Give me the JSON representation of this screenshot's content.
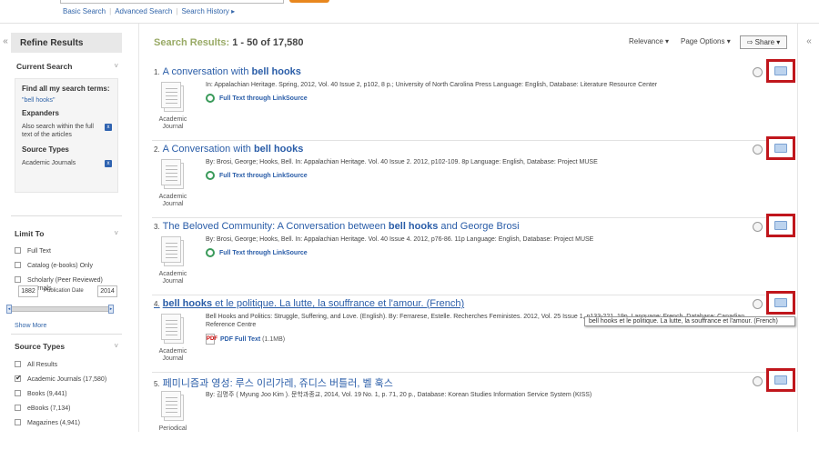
{
  "top_links": {
    "basic": "Basic Search",
    "advanced": "Advanced Search",
    "history": "Search History ▸"
  },
  "sidebar": {
    "title": "Refine Results",
    "current_search": {
      "title": "Current Search",
      "find_all_label": "Find all my search terms:",
      "query": "\"bell hooks\"",
      "expanders_label": "Expanders",
      "expander_item": "Also search within the full text of the articles",
      "source_types_label": "Source Types",
      "source_type_item": "Academic Journals"
    },
    "limit_to": {
      "title": "Limit To",
      "options": [
        {
          "label": "Full Text",
          "checked": false
        },
        {
          "label": "Catalog (e-books) Only",
          "checked": false
        },
        {
          "label": "Scholarly (Peer Reviewed) Journals",
          "checked": false
        }
      ],
      "date_from": "1882",
      "date_label": "Publication Date",
      "date_to": "2014",
      "show_more": "Show More"
    },
    "source_types": {
      "title": "Source Types",
      "options": [
        {
          "label": "All Results",
          "checked": false
        },
        {
          "label": "Academic Journals (17,580)",
          "checked": true
        },
        {
          "label": "Books (9,441)",
          "checked": false
        },
        {
          "label": "eBooks (7,134)",
          "checked": false
        },
        {
          "label": "Magazines (4,941)",
          "checked": false
        }
      ]
    }
  },
  "header": {
    "results_label": "Search Results:",
    "results_count": "1 - 50 of 17,580",
    "relevance": "Relevance ▾",
    "page_options": "Page Options ▾",
    "share": "Share ▾"
  },
  "results": [
    {
      "num": "1.",
      "title_pre": "A conversation with ",
      "title_bold": "bell hooks",
      "title_post": "",
      "type": "Academic Journal",
      "meta": "In: Appalachian Heritage. Spring, 2012, Vol. 40 Issue 2, p102, 8 p.; University of North Carolina Press Language: English, Database: Literature Resource Center",
      "link": "Full Text through LinkSource",
      "link_size": ""
    },
    {
      "num": "2.",
      "title_pre": "A Conversation with ",
      "title_bold": "bell hooks",
      "title_post": "",
      "type": "Academic Journal",
      "meta": "By: Brosi, George; Hooks, Bell. In: Appalachian Heritage. Vol. 40 Issue 2. 2012, p102-109. 8p Language: English, Database: Project MUSE",
      "link": "Full Text through LinkSource",
      "link_size": ""
    },
    {
      "num": "3.",
      "title_pre": "The Beloved Community: A Conversation between ",
      "title_bold": "bell hooks",
      "title_post": " and George Brosi",
      "type": "Academic Journal",
      "meta": "By: Brosi, George; Hooks, Bell. In: Appalachian Heritage. Vol. 40 Issue 4. 2012, p76-86. 11p Language: English, Database: Project MUSE",
      "link": "Full Text through LinkSource",
      "link_size": ""
    },
    {
      "num": "4.",
      "title_pre": "",
      "title_bold": "bell hooks",
      "title_post": " et le politique. La lutte, la souffrance et l'amour. (French)",
      "type": "Academic Journal",
      "meta": "Bell Hooks and Politics: Struggle, Suffering, and Love. (English). By: Ferrarese, Estelle. Recherches Feministes. 2012, Vol. 25 Issue 1, p133-221. 19p. Language: French, Database: Canadian Reference Centre",
      "link": "PDF Full Text",
      "link_size": "(1.1MB)"
    },
    {
      "num": "5.",
      "title_pre": "페미니즘과 영성: 루스 이리가레, 쥬디스 버틀러, 벨 훅스",
      "title_bold": "",
      "title_post": "",
      "type": "Periodical",
      "meta": "By: 김명주 ( Myung Joo Kim ). 문학과종교, 2014, Vol. 19 No. 1, p. 71, 20 p., Database: Korean Studies Information Service System (KISS)",
      "link": "",
      "link_size": ""
    }
  ],
  "tooltip": "bell hooks et le politique. La lutte, la souffrance et l'amour. (French)"
}
